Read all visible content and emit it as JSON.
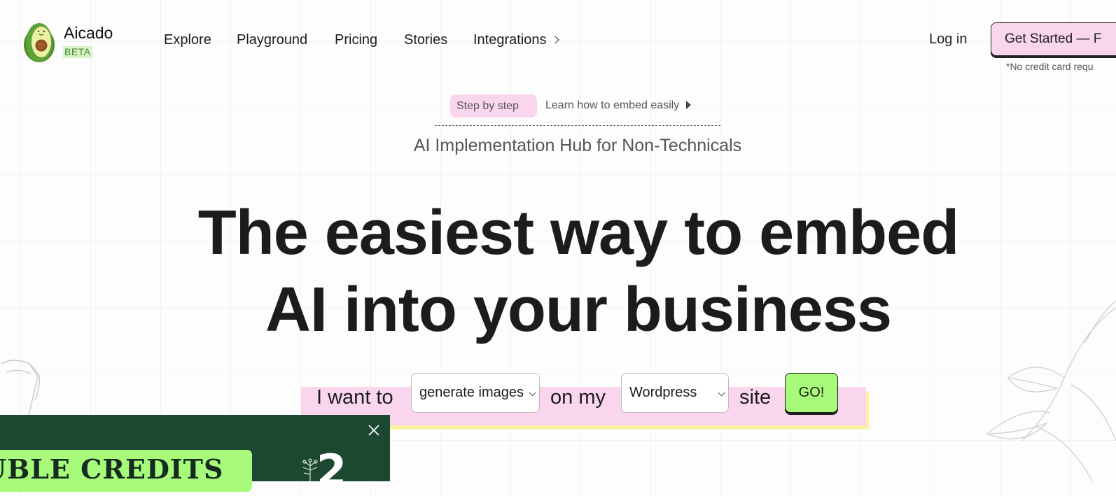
{
  "brand": {
    "name": "Aicado",
    "badge": "BETA"
  },
  "nav": {
    "items": [
      "Explore",
      "Playground",
      "Pricing",
      "Stories",
      "Integrations"
    ]
  },
  "header": {
    "login_label": "Log in",
    "cta_label": "Get Started — F",
    "cta_note": "*No credit card requ"
  },
  "intro": {
    "pill_label": "Step by step",
    "link_label": "Learn how to embed easily",
    "subtitle": "AI Implementation Hub for Non-Technicals"
  },
  "hero": {
    "line1": "The easiest way to embed",
    "line2": "AI into your business"
  },
  "configurator": {
    "prefix": "I want to",
    "action_value": "generate images",
    "middle": "on my",
    "platform_value": "Wordpress",
    "suffix": "site",
    "go_label": "GO!"
  },
  "promo": {
    "badge_text": "UBLE CREDITS",
    "number_text": "2"
  },
  "colors": {
    "pink": "#f9d5ee",
    "green": "#a8fa7b",
    "dark_green": "#1c4731",
    "yellow_shadow": "#fbf2a5"
  }
}
